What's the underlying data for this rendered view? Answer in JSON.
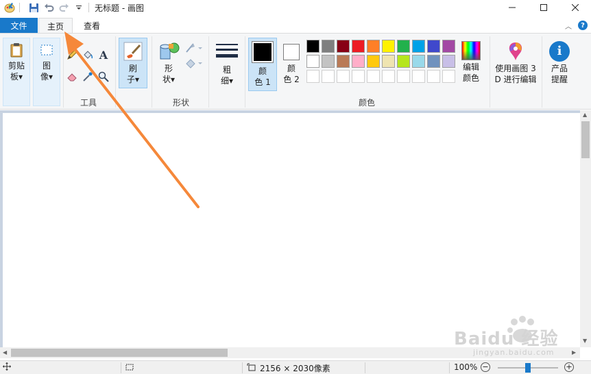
{
  "window": {
    "title": "无标题 - 画图",
    "minimize_icon": "minimize-icon",
    "maximize_icon": "maximize-icon",
    "close_icon": "close-icon"
  },
  "tabs": {
    "file": "文件",
    "home": "主页",
    "view": "查看"
  },
  "ribbon": {
    "clipboard": {
      "label_line1": "剪贴",
      "label_line2": "板▾"
    },
    "image": {
      "label_line1": "图",
      "label_line2": "像▾"
    },
    "tools_group": "工具",
    "brush": {
      "label_line1": "刷",
      "label_line2": "子▾"
    },
    "shapes": {
      "label_line1": "形",
      "label_line2": "状▾"
    },
    "shapes_group": "形状",
    "size": {
      "label_line1": "粗",
      "label_line2": "细▾"
    },
    "color1": {
      "label_line1": "颜",
      "label_line2": "色 1"
    },
    "color2": {
      "label_line1": "颜",
      "label_line2": "色 2"
    },
    "colors_group": "颜色",
    "edit_colors": {
      "label_line1": "编辑",
      "label_line2": "颜色"
    },
    "paint3d": {
      "label_line1": "使用画图 3",
      "label_line2": "D 进行编辑"
    },
    "product_alert": {
      "label_line1": "产品",
      "label_line2": "提醒"
    }
  },
  "palette": {
    "row1": [
      "#000000",
      "#7f7f7f",
      "#880015",
      "#ed1c24",
      "#ff7f27",
      "#fff200",
      "#22b14c",
      "#00a2e8",
      "#3f48cc",
      "#a349a4"
    ],
    "row2": [
      "#ffffff",
      "#c3c3c3",
      "#b97a57",
      "#ffaec9",
      "#ffc90e",
      "#efe4b0",
      "#b5e61d",
      "#99d9ea",
      "#7092be",
      "#c8bfe7"
    ],
    "color1": "#000000",
    "color2": "#ffffff"
  },
  "status": {
    "dimensions": "2156 × 2030像素",
    "zoom": "100%",
    "zoom_level": 0.5
  },
  "watermark": {
    "brand": "Baidu 经验",
    "url": "jingyan.baidu.com"
  },
  "accent": "#1979ca",
  "arrow_color": "#f5883a"
}
